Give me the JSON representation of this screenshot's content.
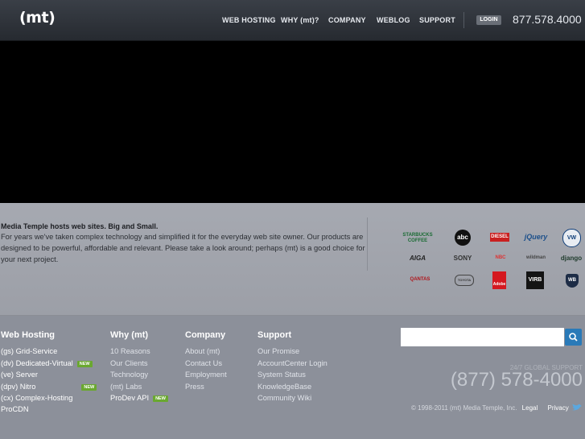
{
  "header": {
    "logo": "(mt)",
    "nav": [
      "WEB HOSTING",
      "WHY (mt)?",
      "COMPANY",
      "WEBLOG",
      "SUPPORT"
    ],
    "login": "LOGIN",
    "phone": "877.578.4000"
  },
  "intro": {
    "title": "Media Temple hosts web sites. Big and Small.",
    "body": "For years we've taken complex technology and simplified it for the everyday web site owner. Our products are designed to be powerful, affordable and relevant. Please take a look around; perhaps (mt) is a good choice for your next project."
  },
  "clients": [
    {
      "name": "STARBUCKS COFFEE"
    },
    {
      "name": "abc"
    },
    {
      "name": "DIESEL"
    },
    {
      "name": "jQuery"
    },
    {
      "name": "VW"
    },
    {
      "name": "AIGA"
    },
    {
      "name": "SONY"
    },
    {
      "name": "NBC"
    },
    {
      "name": "wildman"
    },
    {
      "name": "django"
    },
    {
      "name": "QANTAS"
    },
    {
      "name": "TOYOTA"
    },
    {
      "name": "Adobe"
    },
    {
      "name": "VIRB"
    },
    {
      "name": "WB"
    }
  ],
  "footer": {
    "web_hosting": {
      "title": "Web Hosting",
      "items": [
        {
          "label": "(gs) Grid-Service",
          "badge": ""
        },
        {
          "label": "(dv) Dedicated-Virtual",
          "badge": "NEW"
        },
        {
          "label": "(ve) Server",
          "badge": ""
        },
        {
          "label": "(dpv) Nitro",
          "badge": "NEW"
        },
        {
          "label": "(cx) Complex-Hosting",
          "badge": ""
        },
        {
          "label": "ProCDN",
          "badge": ""
        }
      ]
    },
    "why": {
      "title": "Why (mt)",
      "items": [
        {
          "label": "10 Reasons",
          "badge": ""
        },
        {
          "label": "Our Clients",
          "badge": ""
        },
        {
          "label": "Technology",
          "badge": ""
        },
        {
          "label": "(mt) Labs",
          "badge": ""
        },
        {
          "label": "ProDev API",
          "badge": "NEW"
        }
      ]
    },
    "company": {
      "title": "Company",
      "items": [
        {
          "label": "About (mt)"
        },
        {
          "label": "Contact Us"
        },
        {
          "label": "Employment"
        },
        {
          "label": "Press"
        }
      ]
    },
    "support": {
      "title": "Support",
      "items": [
        {
          "label": "Our Promise"
        },
        {
          "label": "AccountCenter Login"
        },
        {
          "label": "System Status"
        },
        {
          "label": "KnowledgeBase"
        },
        {
          "label": "Community Wiki"
        }
      ]
    },
    "search_placeholder": "",
    "support_label": "24/7 GLOBAL SUPPORT",
    "support_phone": "(877) 578-4000",
    "copyright": "© 1998-2011 (mt) Media Temple, Inc.",
    "legal": "Legal",
    "privacy": "Privacy"
  }
}
